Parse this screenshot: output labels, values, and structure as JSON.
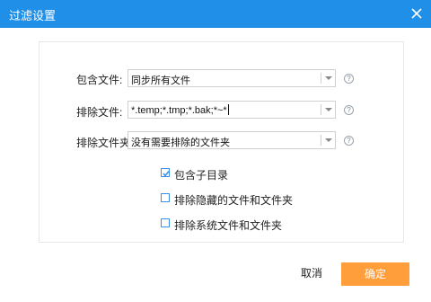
{
  "window": {
    "title": "过滤设置"
  },
  "fields": [
    {
      "label": "包含文件:",
      "value": "同步所有文件",
      "help": "?"
    },
    {
      "label": "排除文件:",
      "value": "*.temp;*.tmp;*.bak;*~*",
      "help": "?"
    },
    {
      "label": "排除文件夹:",
      "value": "没有需要排除的文件夹",
      "help": "?"
    }
  ],
  "options": [
    {
      "label": "包含子目录",
      "checked": true
    },
    {
      "label": "排除隐藏的文件和文件夹",
      "checked": false
    },
    {
      "label": "排除系统文件和文件夹",
      "checked": false
    }
  ],
  "footer": {
    "cancel_label": "取消",
    "ok_label": "确定"
  },
  "colors": {
    "titlebar": "#1f8fe8",
    "ok_button": "#ff9e3a",
    "checkbox_border": "#3c8ee6"
  }
}
